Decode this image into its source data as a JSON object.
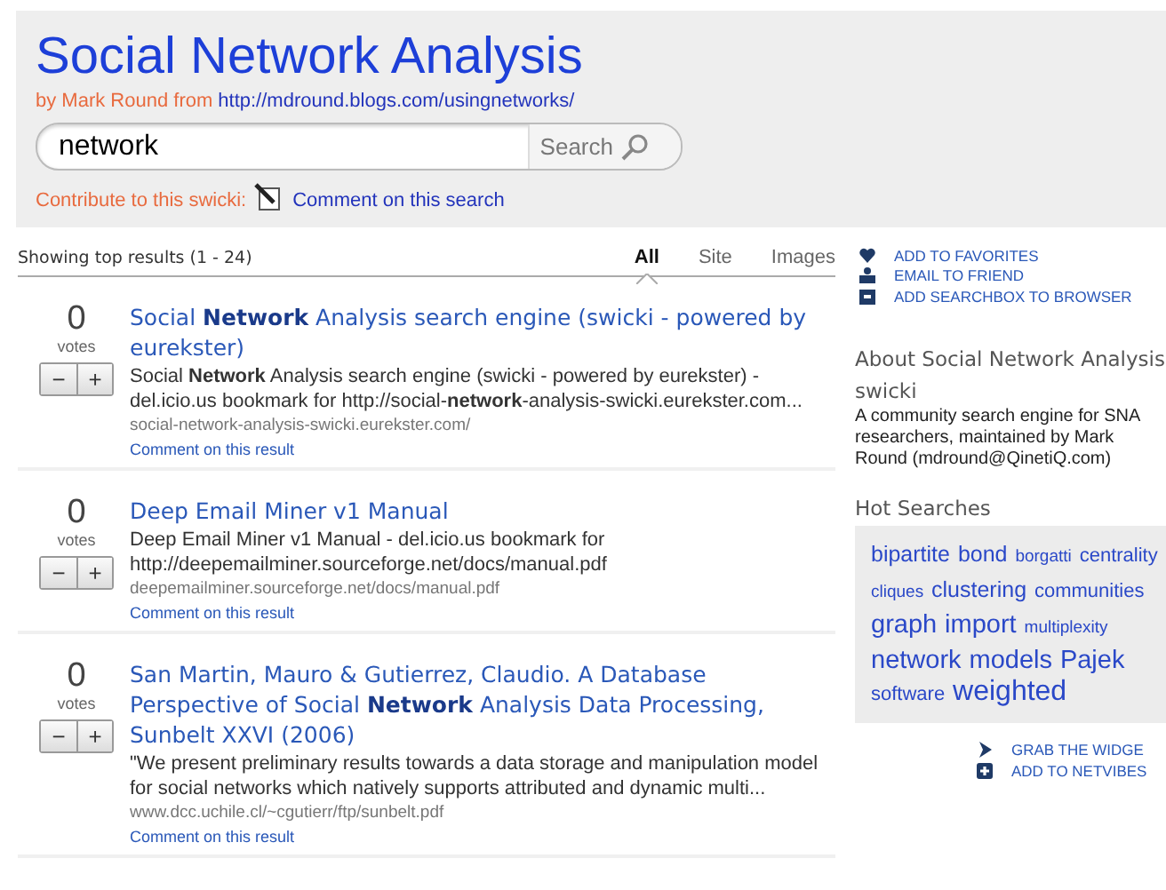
{
  "header": {
    "title": "Social Network Analysis",
    "byline_prefix": "by Mark Round from",
    "byline_link": "http://mdround.blogs.com/usingnetworks/",
    "search": {
      "value": "network",
      "button": "Search"
    },
    "contribute_label": "Contribute to this swicki:",
    "comment_link": "Comment on this search"
  },
  "results_bar": {
    "summary": "Showing top results (1 - 24)",
    "tabs": [
      {
        "label": "All",
        "selected": true
      },
      {
        "label": "Site",
        "selected": false
      },
      {
        "label": "Images",
        "selected": false
      }
    ]
  },
  "results": [
    {
      "votes": "0",
      "votes_label": "votes",
      "minus": "−",
      "plus": "+",
      "title": "Social **Network** Analysis search engine (swicki - powered by eurekster)",
      "snippet": "Social **Network** Analysis search engine (swicki - powered by eurekster) - del.icio.us bookmark for http://social-**network**-analysis-swicki.eurekster.com...",
      "url": "social-network-analysis-swicki.eurekster.com/",
      "comment": "Comment on this result"
    },
    {
      "votes": "0",
      "votes_label": "votes",
      "minus": "−",
      "plus": "+",
      "title": "Deep Email Miner v1 Manual",
      "snippet": "Deep Email Miner v1 Manual - del.icio.us bookmark for http://deepemailminer.sourceforge.net/docs/manual.pdf",
      "url": "deepemailminer.sourceforge.net/docs/manual.pdf",
      "comment": "Comment on this result"
    },
    {
      "votes": "0",
      "votes_label": "votes",
      "minus": "−",
      "plus": "+",
      "title": "San Martin, Mauro & Gutierrez, Claudio. A Database Perspective of Social **Network** Analysis Data Processing, Sunbelt XXVI (2006)",
      "snippet": "\"We present preliminary results towards a data storage and manipulation model for social networks which natively supports attributed and dynamic multi...",
      "url": "www.dcc.uchile.cl/~cgutierr/ftp/sunbelt.pdf",
      "comment": "Comment on this result"
    }
  ],
  "sidebar": {
    "actions": [
      {
        "kind": "heart",
        "label": "ADD TO FAVORITES"
      },
      {
        "kind": "mail",
        "label": "EMAIL TO FRIEND"
      },
      {
        "kind": "box",
        "label": "ADD SEARCHBOX TO BROWSER"
      }
    ],
    "about_heading": "About Social Network Analysis swicki",
    "about_text": "A community search engine for SNA researchers, maintained by Mark Round (mdround@QinetiQ.com)",
    "hot_heading": "Hot Searches",
    "tags": [
      {
        "label": "bipartite",
        "kind": "medium"
      },
      {
        "label": "bond",
        "kind": "medium"
      },
      {
        "label": "borgatti",
        "kind": "tiny"
      },
      {
        "label": "centrality",
        "kind": "small"
      },
      {
        "label": "cliques",
        "kind": "tiny"
      },
      {
        "label": "clustering",
        "kind": "medium"
      },
      {
        "label": "communities",
        "kind": "small"
      },
      {
        "label": "graph",
        "kind": "large"
      },
      {
        "label": "import",
        "kind": "large"
      },
      {
        "label": "multiplexity",
        "kind": "tiny"
      },
      {
        "label": "network",
        "kind": "large"
      },
      {
        "label": "models",
        "kind": "large"
      },
      {
        "label": "Pajek",
        "kind": "large"
      },
      {
        "label": "software",
        "kind": "small"
      },
      {
        "label": "weighted",
        "kind": "huge"
      }
    ],
    "widgets": [
      {
        "kind": "play",
        "label": "GRAB THE WIDGE"
      },
      {
        "kind": "plus",
        "label": "ADD TO NETVIBES"
      }
    ]
  }
}
